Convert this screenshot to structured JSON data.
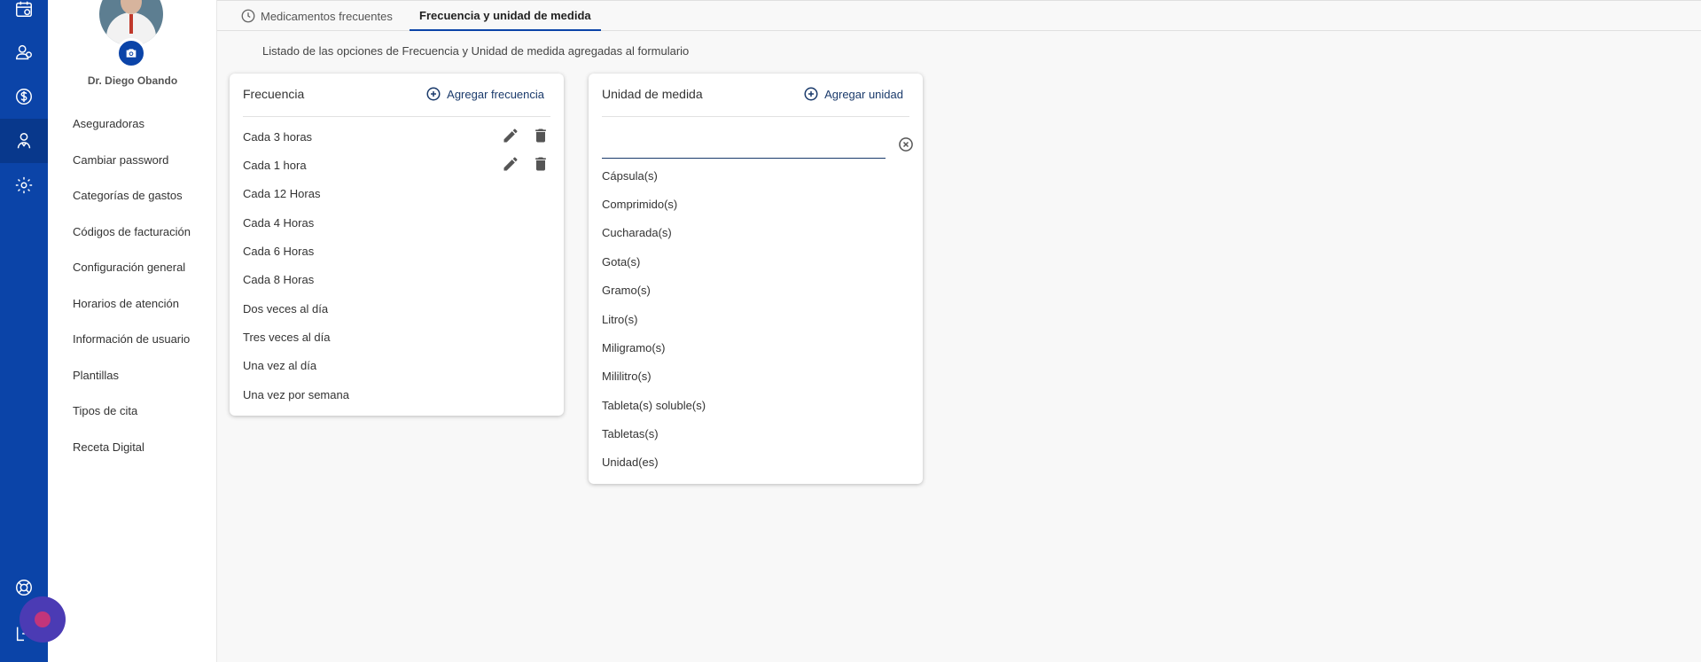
{
  "user": {
    "name": "Dr. Diego Obando"
  },
  "rail_icons": [
    "calendar-icon",
    "patients-icon",
    "dollar-icon",
    "doctor-icon",
    "settings-icon",
    "support-icon",
    "logout-icon"
  ],
  "sidebar": {
    "items": [
      {
        "label": "Aseguradoras"
      },
      {
        "label": "Cambiar password"
      },
      {
        "label": "Categorías de gastos"
      },
      {
        "label": "Códigos de facturación"
      },
      {
        "label": "Configuración general"
      },
      {
        "label": "Horarios de atención"
      },
      {
        "label": "Información de usuario"
      },
      {
        "label": "Plantillas"
      },
      {
        "label": "Tipos de cita"
      },
      {
        "label": "Receta Digital"
      }
    ]
  },
  "tabs": [
    {
      "label": "Medicamentos frecuentes",
      "active": false
    },
    {
      "label": "Frecuencia y unidad de medida",
      "active": true
    }
  ],
  "description": "Listado de las opciones de Frecuencia y Unidad de medida agregadas al formulario",
  "frecuencia": {
    "title": "Frecuencia",
    "action_label": "Agregar frecuencia",
    "items": [
      {
        "label": "Cada 3 horas",
        "editable": true
      },
      {
        "label": "Cada 1 hora",
        "editable": true
      },
      {
        "label": "Cada 12 Horas",
        "editable": false
      },
      {
        "label": "Cada 4 Horas",
        "editable": false
      },
      {
        "label": "Cada 6 Horas",
        "editable": false
      },
      {
        "label": "Cada 8 Horas",
        "editable": false
      },
      {
        "label": "Dos veces al día",
        "editable": false
      },
      {
        "label": "Tres veces al día",
        "editable": false
      },
      {
        "label": "Una vez al día",
        "editable": false
      },
      {
        "label": "Una vez por semana",
        "editable": false
      }
    ]
  },
  "unidad": {
    "title": "Unidad de medida",
    "action_label": "Agregar unidad",
    "search_value": "",
    "items": [
      "Cápsula(s)",
      "Comprimido(s)",
      "Cucharada(s)",
      "Gota(s)",
      "Gramo(s)",
      "Litro(s)",
      "Miligramo(s)",
      "Mililitro(s)",
      "Tableta(s) soluble(s)",
      "Tabletas(s)",
      "Unidad(es)"
    ]
  },
  "colors": {
    "brand": "#0b44a8",
    "action_text": "#1a3a6b"
  }
}
